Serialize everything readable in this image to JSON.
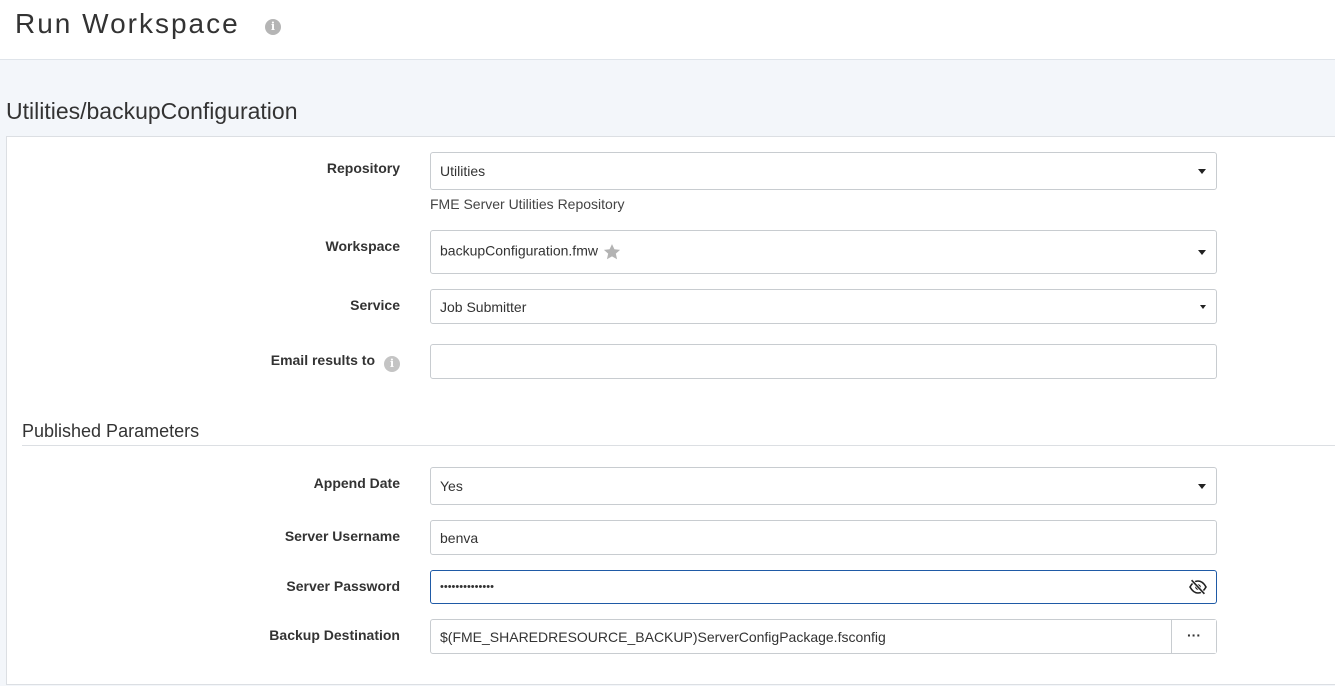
{
  "header": {
    "title": "Run Workspace"
  },
  "workspace_path": "Utilities/backupConfiguration",
  "form": {
    "repository": {
      "label": "Repository",
      "value": "Utilities",
      "help": "FME Server Utilities Repository"
    },
    "workspace": {
      "label": "Workspace",
      "value": "backupConfiguration.fmw"
    },
    "service": {
      "label": "Service",
      "value": "Job Submitter"
    },
    "email": {
      "label": "Email results to",
      "value": ""
    }
  },
  "published_parameters": {
    "title": "Published Parameters",
    "append_date": {
      "label": "Append Date",
      "value": "Yes"
    },
    "server_username": {
      "label": "Server Username",
      "value": "benva"
    },
    "server_password": {
      "label": "Server Password",
      "value": "••••••••••••••"
    },
    "backup_destination": {
      "label": "Backup Destination",
      "value": "$(FME_SHAREDRESOURCE_BACKUP)ServerConfigPackage.fsconfig",
      "browse_label": "···"
    }
  },
  "icons": {
    "title_info": "info-icon",
    "favorite": "star-icon",
    "email_info": "info-icon",
    "password_toggle": "eye-slash-icon"
  },
  "colors": {
    "focus_border": "#1f5aa6",
    "content_background": "#f3f6fa"
  }
}
